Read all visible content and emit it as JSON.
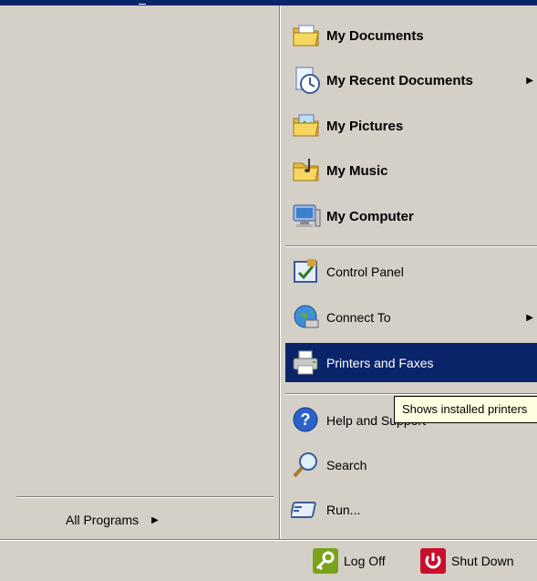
{
  "left_panel": {
    "all_programs_label": "All Programs"
  },
  "right_panel": {
    "items": [
      {
        "label": "My Documents",
        "icon": "folder-documents-icon"
      },
      {
        "label": "My Recent Documents",
        "icon": "recent-documents-icon",
        "has_submenu": true
      },
      {
        "label": "My Pictures",
        "icon": "folder-pictures-icon"
      },
      {
        "label": "My Music",
        "icon": "folder-music-icon"
      },
      {
        "label": "My Computer",
        "icon": "computer-icon"
      },
      {
        "label": "Control Panel",
        "icon": "control-panel-icon"
      },
      {
        "label": "Connect To",
        "icon": "globe-connect-icon",
        "has_submenu": true
      },
      {
        "label": "Printers and Faxes",
        "icon": "printer-icon",
        "selected": true
      },
      {
        "label": "Help and Support",
        "icon": "help-icon"
      },
      {
        "label": "Search",
        "icon": "search-magnifier-icon"
      },
      {
        "label": "Run...",
        "icon": "run-icon"
      }
    ]
  },
  "tooltip": {
    "text": "Shows installed printers"
  },
  "bottom_bar": {
    "log_off_label": "Log Off",
    "shut_down_label": "Shut Down"
  },
  "colors": {
    "menu_background": "#d4d0c8",
    "selection": "#0a246a",
    "tooltip_background": "#ffffe1",
    "shutdown_red": "#c8102e",
    "logoff_green": "#7aa31c"
  }
}
